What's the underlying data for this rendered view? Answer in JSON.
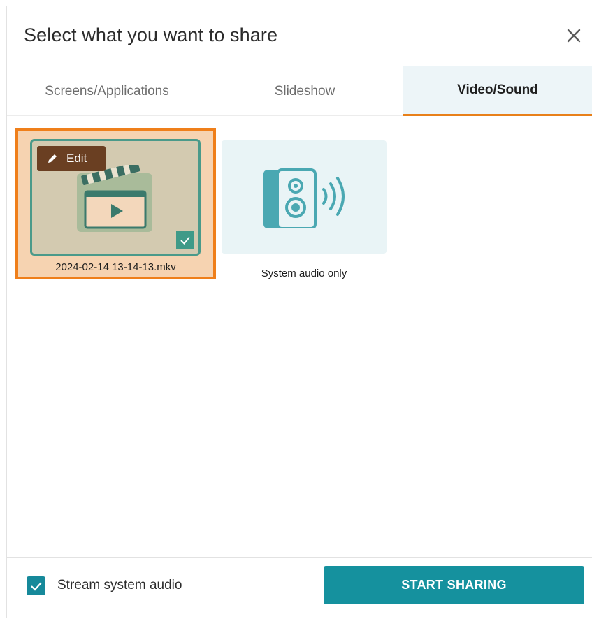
{
  "dialog": {
    "title": "Select what you want to share"
  },
  "tabs": [
    {
      "label": "Screens/Applications",
      "active": false
    },
    {
      "label": "Slideshow",
      "active": false
    },
    {
      "label": "Video/Sound",
      "active": true
    }
  ],
  "items": [
    {
      "caption": "2024-02-14 13-14-13.mkv",
      "edit_label": "Edit",
      "selected": true,
      "icon": "clapperboard-play-icon"
    },
    {
      "caption": "System audio only",
      "selected": false,
      "icon": "speaker-sound-icon"
    }
  ],
  "footer": {
    "stream_audio_label": "Stream system audio",
    "stream_audio_checked": true,
    "start_button": "START SHARING"
  },
  "colors": {
    "accent_orange": "#ef7f1a",
    "teal": "#15919e",
    "selected_bg": "#f6d3b1",
    "active_tab_bg": "#edf5f8"
  }
}
